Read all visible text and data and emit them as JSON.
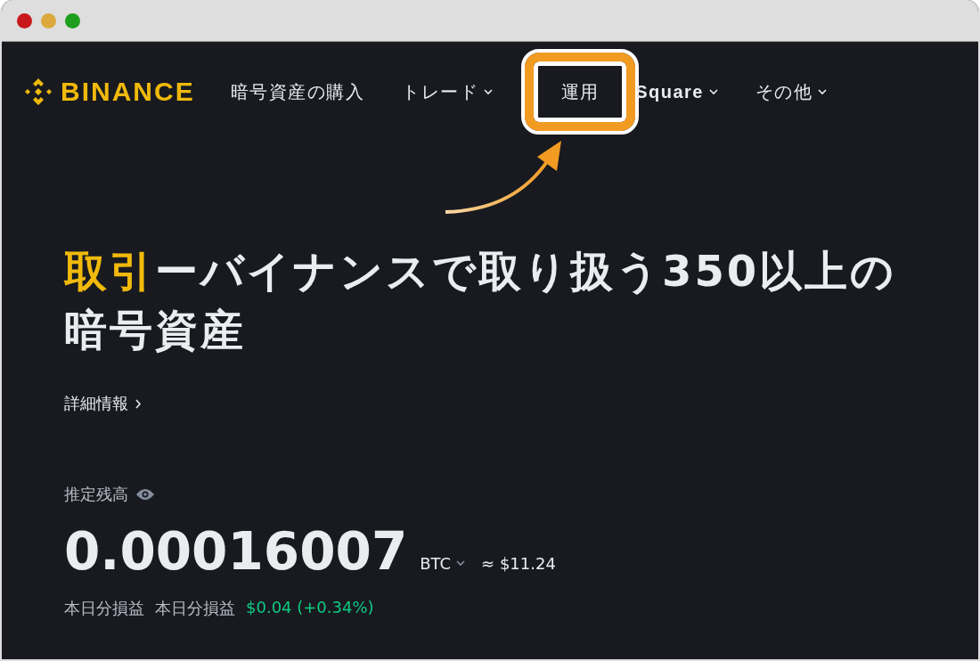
{
  "logo": {
    "text": "BINANCE"
  },
  "nav": [
    {
      "label": "暗号資産の購入",
      "dropdown": false,
      "highlighted": false
    },
    {
      "label": "トレード",
      "dropdown": true,
      "highlighted": false
    },
    {
      "label": "運用",
      "dropdown": false,
      "highlighted": true
    },
    {
      "label": "Square",
      "dropdown": true,
      "highlighted": false
    },
    {
      "label": "その他",
      "dropdown": true,
      "highlighted": false
    }
  ],
  "headline": {
    "accent": "取引",
    "text": "ーバイナンスで取り扱う350以上の暗号資産"
  },
  "more_link": "詳細情報",
  "balance": {
    "label": "推定残高",
    "amount": "0.00016007",
    "currency": "BTC",
    "fiat": "≈ $11.24"
  },
  "pnl": {
    "labels": [
      "本日分損益",
      "本日分損益"
    ],
    "value": "$0.04 (+0.34%)"
  }
}
